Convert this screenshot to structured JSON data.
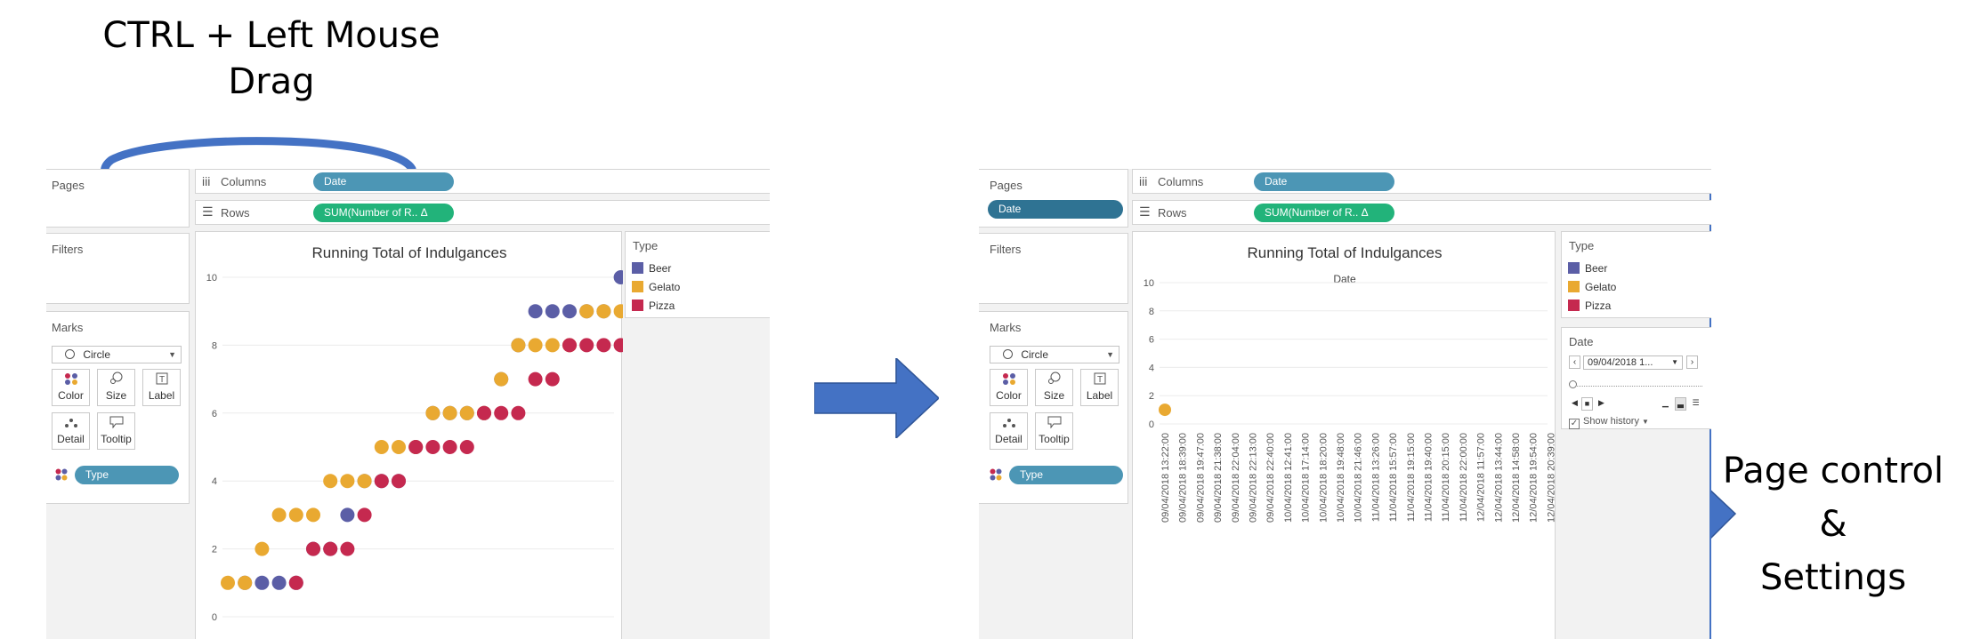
{
  "annotations": {
    "drag_text_line1": "CTRL + Left Mouse",
    "drag_text_line2": "Drag",
    "page_control_line1": "Page control",
    "page_control_line2": "&",
    "page_control_line3": "Settings"
  },
  "shelves": {
    "pages": "Pages",
    "filters": "Filters",
    "marks": "Marks",
    "columns": "Columns",
    "rows": "Rows"
  },
  "pills": {
    "date": "Date",
    "rows_measure": "SUM(Number of R..  Δ",
    "type": "Type"
  },
  "marks_card": {
    "mark_type": "Circle",
    "buttons": [
      "Color",
      "Size",
      "Label",
      "Detail",
      "Tooltip"
    ]
  },
  "legend": {
    "title": "Type",
    "items": [
      {
        "label": "Beer",
        "color": "#5b5ea6"
      },
      {
        "label": "Gelato",
        "color": "#e9a931"
      },
      {
        "label": "Pizza",
        "color": "#c5294f"
      }
    ]
  },
  "chart_title": "Running Total of Indulgances",
  "right_chart_subtitle": "Date",
  "page_control": {
    "title": "Date",
    "current_value": "09/04/2018 1...",
    "show_history": "Show history"
  },
  "colors": {
    "beer": "#5b5ea6",
    "beer_dark": "#4b3f7e",
    "gelato": "#e9a931",
    "gelato_dark": "#e0892a",
    "pizza": "#c5294f",
    "arrow": "#4472c4",
    "pill_blue": "#4c96b5",
    "pill_green": "#22b37a"
  },
  "chart_data": [
    {
      "type": "scatter",
      "title": "Running Total of Indulgances",
      "ylim": [
        0,
        10
      ],
      "yticks": [
        0,
        2,
        4,
        6,
        8,
        10
      ],
      "x": [
        0,
        1,
        2,
        3,
        4,
        5,
        6,
        7,
        8,
        9,
        10,
        11,
        12,
        13,
        14,
        15,
        16,
        17,
        18,
        19,
        20,
        21,
        22,
        23
      ],
      "series": [
        {
          "name": "Beer",
          "color": "#5b5ea6",
          "values": [
            0,
            1,
            1,
            1,
            1,
            2,
            2,
            3,
            4,
            4,
            4,
            5,
            6,
            6,
            6,
            6,
            7,
            8,
            9,
            9,
            9,
            9,
            9,
            10
          ]
        },
        {
          "name": "Gelato",
          "color": "#e9a931",
          "values": [
            1,
            1,
            2,
            3,
            3,
            3,
            4,
            4,
            4,
            5,
            5,
            5,
            6,
            6,
            6,
            6,
            7,
            8,
            8,
            8,
            8,
            9,
            9,
            9
          ]
        },
        {
          "name": "Pizza",
          "color": "#c5294f",
          "values": [
            0,
            0,
            0,
            0,
            1,
            2,
            2,
            2,
            3,
            4,
            4,
            5,
            5,
            5,
            5,
            6,
            6,
            6,
            7,
            7,
            8,
            8,
            8,
            8
          ]
        }
      ]
    },
    {
      "type": "scatter",
      "title": "Running Total of Indulgances",
      "ylim": [
        0,
        10
      ],
      "yticks": [
        0,
        2,
        4,
        6,
        8,
        10
      ],
      "x": [
        "09/04/2018 13:22:00",
        "09/04/2018 18:39:00",
        "09/04/2018 19:47:00",
        "09/04/2018 21:38:00",
        "09/04/2018 22:04:00",
        "09/04/2018 22:13:00",
        "09/04/2018 22:40:00",
        "10/04/2018 12:41:00",
        "10/04/2018 17:14:00",
        "10/04/2018 18:20:00",
        "10/04/2018 19:48:00",
        "10/04/2018 21:46:00",
        "11/04/2018 13:26:00",
        "11/04/2018 15:57:00",
        "11/04/2018 19:15:00",
        "11/04/2018 19:40:00",
        "11/04/2018 20:15:00",
        "11/04/2018 22:00:00",
        "12/04/2018 11:57:00",
        "12/04/2018 13:44:00",
        "12/04/2018 14:58:00",
        "12/04/2018 19:54:00",
        "12/04/2018 20:39:00"
      ],
      "series": [
        {
          "name": "Gelato",
          "color": "#e9a931",
          "values": [
            1
          ]
        }
      ]
    }
  ]
}
